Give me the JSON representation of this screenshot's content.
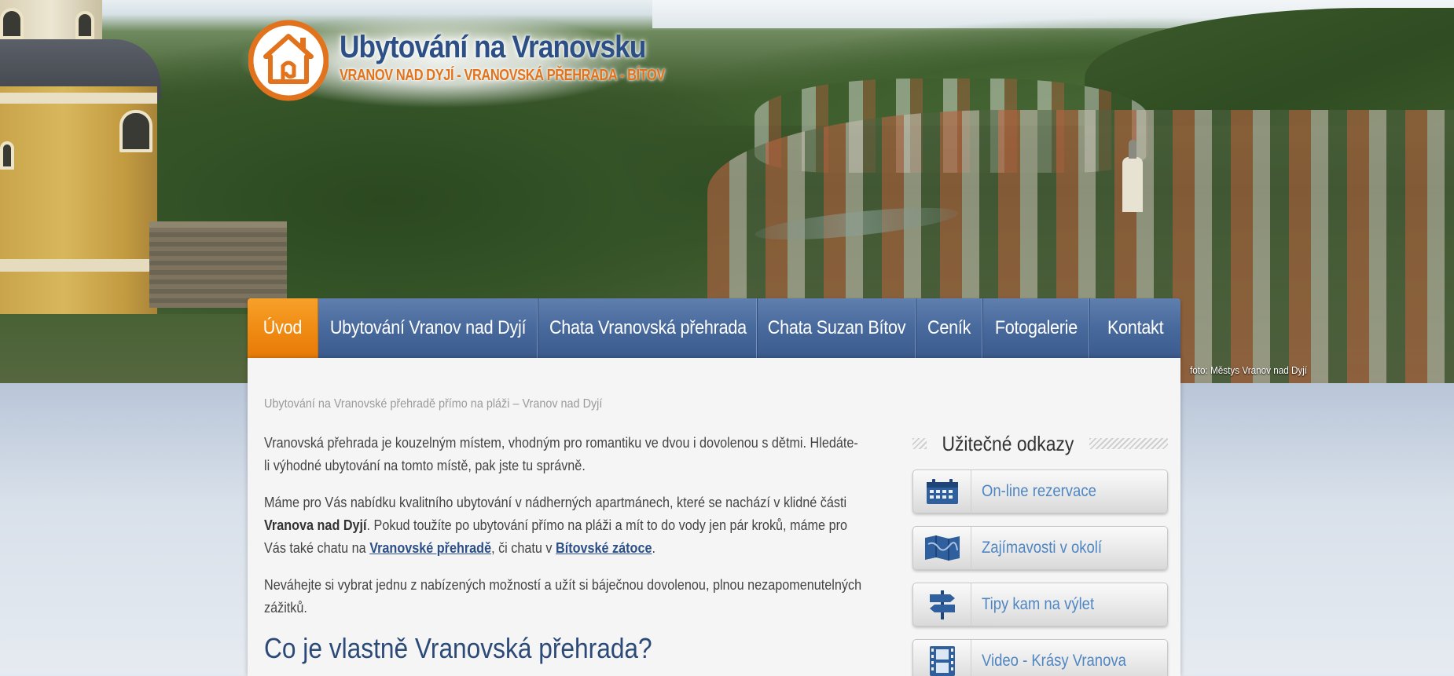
{
  "site": {
    "title": "Ubytování na Vranovsku",
    "subtitle": "VRANOV NAD DYJÍ - VRANOVSKÁ PŘEHRADA - BÍTOV",
    "photo_credit": "foto: Městys Vranov nad Dyjí",
    "brand_color": "#2c4f86",
    "accent_color": "#ef8a12"
  },
  "nav": {
    "items": [
      {
        "label": "Úvod",
        "active": true
      },
      {
        "label": "Ubytování Vranov nad Dyjí",
        "active": false
      },
      {
        "label": "Chata Vranovská přehrada",
        "active": false
      },
      {
        "label": "Chata Suzan Bítov",
        "active": false
      },
      {
        "label": "Ceník",
        "active": false
      },
      {
        "label": "Fotogalerie",
        "active": false
      },
      {
        "label": "Kontakt",
        "active": false
      }
    ]
  },
  "content": {
    "breadcrumb": "Ubytování na Vranovské přehradě přímo na pláži – Vranov nad Dyjí",
    "p1": "Vranovská přehrada je kouzelným místem, vhodným pro romantiku ve dvou i dovolenou s dětmi. Hledáte-li výhodné ubytování na tomto místě, pak jste tu správně.",
    "p2_a": "Máme pro Vás nabídku kvalitního ubytování v nádherných apartmánech, které se nachází v klidné části ",
    "p2_bold": "Vranova nad Dyjí",
    "p2_b": ". Pokud toužíte po ubytování přímo na pláži a mít to do vody jen pár kroků, máme pro Vás také chatu na ",
    "p2_link1": "Vranovské přehradě",
    "p2_c": ", či chatu v ",
    "p2_link2": "Bítovské zátoce",
    "p2_d": ".",
    "p3": "Neváhejte si vybrat jednu z nabízených možností a užít si báječnou dovolenou, plnou nezapomenutelných zážitků.",
    "h2": "Co je vlastně Vranovská přehrada?"
  },
  "sidebar": {
    "title": "Užitečné odkazy",
    "links": [
      {
        "label": "On-line rezervace",
        "icon": "calendar-icon"
      },
      {
        "label": "Zajímavosti v okolí",
        "icon": "map-icon"
      },
      {
        "label": "Tipy kam na výlet",
        "icon": "signpost-icon"
      },
      {
        "label": "Video - Krásy Vranova",
        "icon": "film-icon"
      }
    ]
  }
}
